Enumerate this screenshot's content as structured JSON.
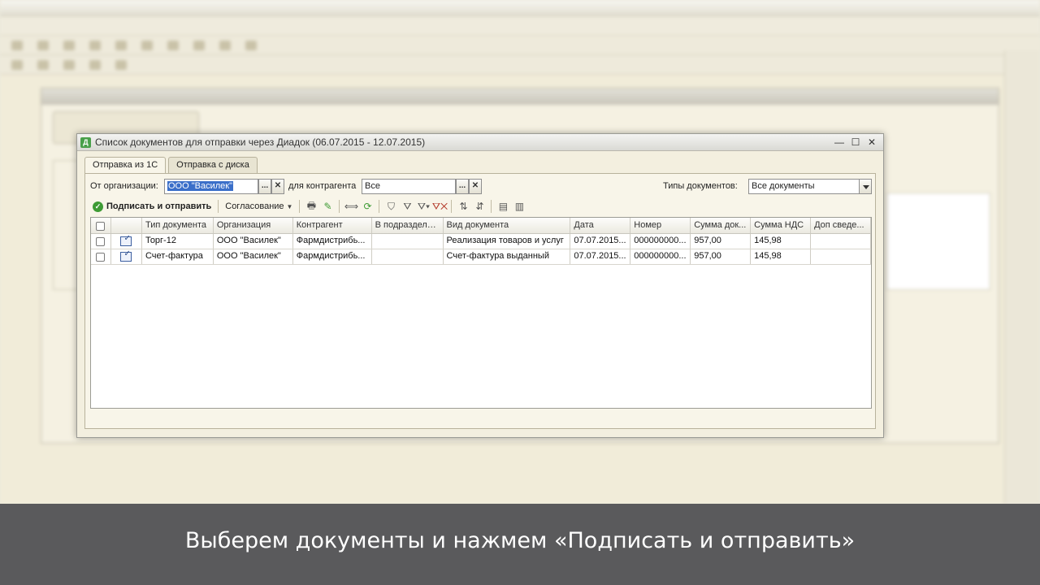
{
  "dialog": {
    "title": "Список документов для отправки через Диадок (06.07.2015 - 12.07.2015)",
    "icon_letter": "Д"
  },
  "tabs": [
    {
      "label": "Отправка из 1С",
      "active": true
    },
    {
      "label": "Отправка с диска",
      "active": false
    }
  ],
  "filters": {
    "org_label": "От организации:",
    "org_value": "ООО \"Василек\"",
    "counterparty_label": "для контрагента",
    "counterparty_value": "Все",
    "doc_types_label": "Типы документов:",
    "doc_types_value": "Все документы",
    "select_btn": "...",
    "clear_btn": "✕"
  },
  "toolbar": {
    "sign_send": "Подписать и отправить",
    "approval": "Согласование"
  },
  "table": {
    "columns": [
      "",
      "",
      "Тип документа",
      "Организация",
      "Контрагент",
      "В подразделе...",
      "Вид документа",
      "Дата",
      "Номер",
      "Сумма док...",
      "Сумма НДС",
      "Доп сведе..."
    ],
    "rows": [
      [
        "",
        "",
        "Торг-12",
        "ООО \"Василек\"",
        "Фармдистрибь...",
        "",
        "Реализация товаров и услуг",
        "07.07.2015...",
        "000000000...",
        "957,00",
        "145,98",
        ""
      ],
      [
        "",
        "",
        "Счет-фактура",
        "ООО \"Василек\"",
        "Фармдистрибь...",
        "",
        "Счет-фактура выданный",
        "07.07.2015...",
        "000000000...",
        "957,00",
        "145,98",
        ""
      ]
    ]
  },
  "caption": "Выберем документы и нажмем «Подписать и отправить»",
  "colors": {
    "caption_bg": "#5a5a5c",
    "accent_green": "#3e9b35",
    "selection_blue": "#3b6fc9"
  }
}
